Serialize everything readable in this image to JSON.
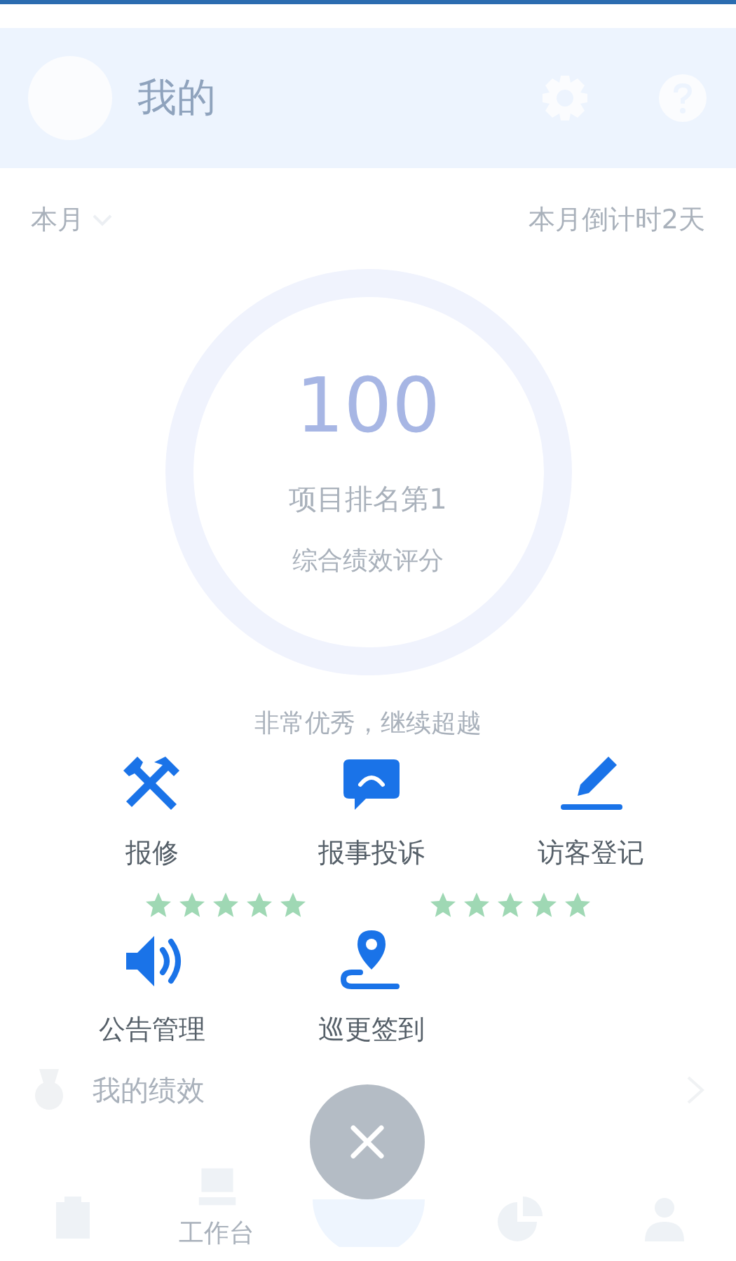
{
  "header": {
    "title": "我的"
  },
  "period": {
    "label": "本月",
    "countdown": "本月倒计时2天"
  },
  "score": {
    "value": "100",
    "rank": "项目排名第1",
    "caption": "综合绩效评分",
    "comment": "非常优秀，继续超越"
  },
  "stat_cards": [
    {
      "stars": 5
    },
    {
      "stars": 5
    }
  ],
  "my_performance": {
    "label": "我的绩效"
  },
  "bottom_nav": [
    {
      "kind": "clipboard"
    },
    {
      "kind": "desk",
      "label": "工作台"
    },
    {
      "kind": "plus"
    },
    {
      "kind": "chart"
    },
    {
      "kind": "person"
    }
  ],
  "quick_menu": [
    {
      "kind": "repair",
      "label": "报修"
    },
    {
      "kind": "chat",
      "label": "报事投诉"
    },
    {
      "kind": "pen",
      "label": "访客登记"
    },
    {
      "kind": "speaker",
      "label": "公告管理"
    },
    {
      "kind": "route",
      "label": "巡更签到"
    }
  ]
}
